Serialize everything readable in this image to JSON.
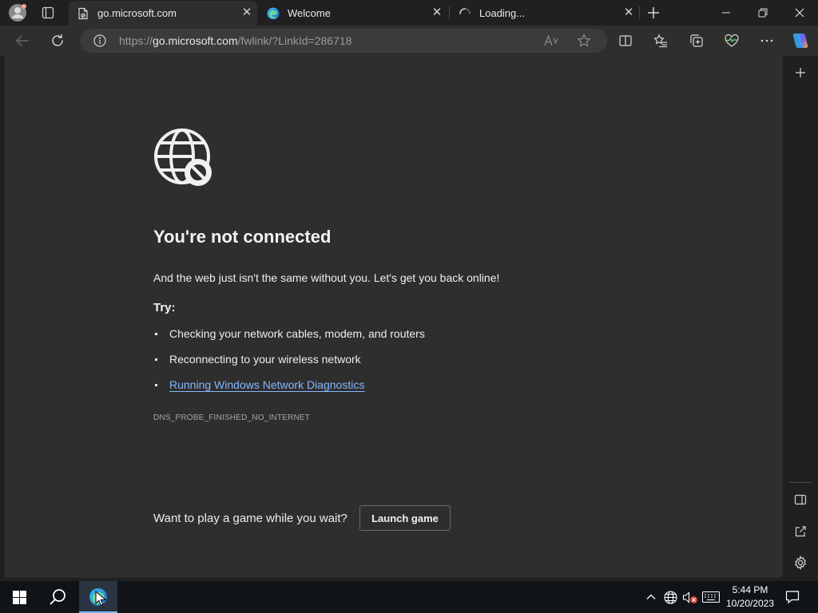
{
  "tabs": [
    {
      "title": "go.microsoft.com",
      "active": true
    },
    {
      "title": "Welcome",
      "active": false
    },
    {
      "title": "Loading...",
      "active": false
    }
  ],
  "address": {
    "scheme": "https://",
    "host": "go.microsoft.com",
    "path": "/fwlink/?LinkId=286718"
  },
  "error_page": {
    "title": "You're not connected",
    "subtitle": "And the web just isn't the same without you. Let's get you back online!",
    "try_label": "Try:",
    "suggestions": [
      "Checking your network cables, modem, and routers",
      "Reconnecting to your wireless network"
    ],
    "diagnostics_link": "Running Windows Network Diagnostics",
    "error_code": "DNS_PROBE_FINISHED_NO_INTERNET",
    "game_prompt": "Want to play a game while you wait?",
    "game_button": "Launch game"
  },
  "clock": {
    "time": "5:44 PM",
    "date": "10/20/2023"
  },
  "colors": {
    "link": "#86b7ff",
    "accent": "#76b9ed"
  }
}
